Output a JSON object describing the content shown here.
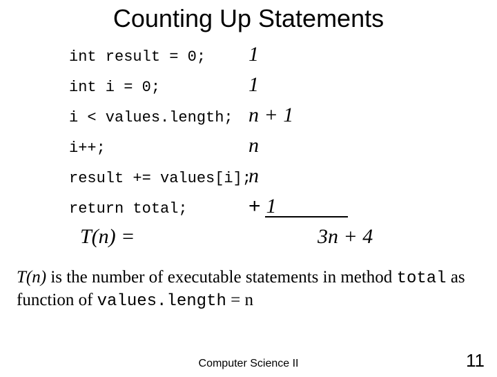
{
  "title": "Counting Up Statements",
  "rows": [
    {
      "code": "int result = 0;",
      "count": "1"
    },
    {
      "code": "int i = 0;",
      "count": "1"
    },
    {
      "code": "i < values.length;",
      "count": "n + 1"
    },
    {
      "code": "i++;",
      "count": "n"
    },
    {
      "code": "result += values[i];",
      "count": "n"
    },
    {
      "code": "return total;",
      "count": "1"
    }
  ],
  "last_row_prefix": "+",
  "result": {
    "label_lhs": "T(n) =",
    "value": "3n + 4"
  },
  "explain": {
    "p1": "T(n)",
    "p2": " is the number of executable statements in method ",
    "p3": "total",
    "p4": " as function of ",
    "p5": "values.length",
    "p6": " = n"
  },
  "footer": "Computer Science II",
  "page_number": "11"
}
